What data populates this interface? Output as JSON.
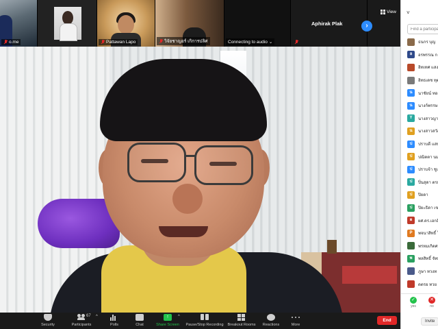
{
  "filmstrip": {
    "tiles": [
      {
        "label": "o.me"
      },
      {
        "label": ""
      },
      {
        "label": "Pattawan Lapo"
      },
      {
        "label": "วิจัยชาญอร์ เกิการปลิศ"
      },
      {
        "label": "Connecting to audio"
      },
      {
        "label": "Aphirak Plak"
      }
    ],
    "next_symbol": "›",
    "view_label": "View"
  },
  "toolbar": {
    "security": "Security",
    "participants": "Participants",
    "participants_count": "67",
    "polls": "Polls",
    "chat": "Chat",
    "share_screen": "Share Screen",
    "share_icon_glyph": "↑",
    "recording": "Pause/Stop Recording",
    "breakout": "Breakout Rooms",
    "reactions": "Reactions",
    "more": "More",
    "caret": "^",
    "end": "End"
  },
  "panel": {
    "collapse_symbol": "˅",
    "search_placeholder": "Find a participant",
    "participants": [
      {
        "initial": "",
        "name": "ธนกร บุญ",
        "color": "#8a6a4a"
      },
      {
        "initial": "อ",
        "name": "อรพรรณ ก",
        "color": "#2f4a8a"
      },
      {
        "initial": "",
        "name": "อิทเทศ แสง",
        "color": "#b84a2a"
      },
      {
        "initial": "",
        "name": "อิทธเดช ทุตส",
        "color": "#7a7a7a"
      },
      {
        "initial": "น",
        "name": "นาชัยน์ ทอง",
        "color": "#2d8cff"
      },
      {
        "initial": "น",
        "name": "นางก์พรรษ",
        "color": "#2d8cff"
      },
      {
        "initial": "Y",
        "name": "นางสาวญาน",
        "color": "#2aa9a0"
      },
      {
        "initial": "น",
        "name": "นางสาวสวัส",
        "color": "#e0a020"
      },
      {
        "initial": "ป",
        "name": "ปราบดี แสน",
        "color": "#2d8cff"
      },
      {
        "initial": "ป",
        "name": "ปณิตตา นมน",
        "color": "#e0a020"
      },
      {
        "initial": "ป",
        "name": "ปราบจ้า ชูเ",
        "color": "#2d8cff"
      },
      {
        "initial": "ป",
        "name": "ปิ่นสุดา ตรยุ",
        "color": "#2aa9a0"
      },
      {
        "initial": "ป",
        "name": "ปิยดา",
        "color": "#e0a020"
      },
      {
        "initial": "ป",
        "name": "ปิยะธิดา เขต",
        "color": "#2aa060"
      },
      {
        "initial": "ผ",
        "name": "ผศ.ดร.เอกสิ",
        "color": "#c03a2a"
      },
      {
        "initial": "P",
        "name": "พจนาสิทธิ์ ใจ",
        "color": "#e07a20"
      },
      {
        "initial": "",
        "name": "พรหมเกิดศร",
        "color": "#3a6a3a"
      },
      {
        "initial": "พ",
        "name": "พลสิทธิ์ จัทม",
        "color": "#2aa060"
      },
      {
        "initial": "",
        "name": "ภูษา ทวงท",
        "color": "#4a5a8a"
      },
      {
        "initial": "",
        "name": "ดตรย ทวย",
        "color": "#c03a2a"
      }
    ],
    "footer": {
      "yes_label": "yes",
      "yes_symbol": "✓",
      "no_label": "no",
      "no_symbol": "✕",
      "invite": "Invite"
    }
  },
  "colors": {
    "accent": "#2d8cff",
    "share_green": "#23c24b",
    "end_red": "#e02828"
  }
}
